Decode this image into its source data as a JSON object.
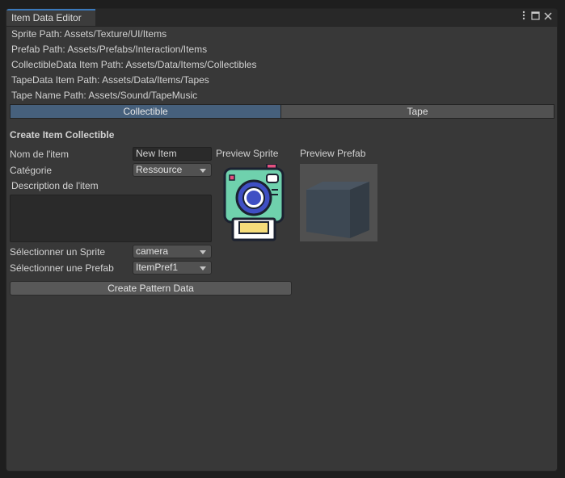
{
  "window": {
    "tab_title": "Item Data Editor",
    "menu_icon": "kebab-menu-icon",
    "maximize_icon": "maximize-icon",
    "close_icon": "close-icon"
  },
  "paths": [
    "Sprite Path: Assets/Texture/UI/Items",
    "Prefab Path: Assets/Prefabs/Interaction/Items",
    "CollectibleData Item Path: Assets/Data/Items/Collectibles",
    "TapeData Item Path: Assets/Data/Items/Tapes",
    "Tape Name Path: Assets/Sound/TapeMusic"
  ],
  "mode_toggle": {
    "collectible": "Collectible",
    "tape": "Tape",
    "active": "Collectible",
    "active_color": "#46607c"
  },
  "form": {
    "section_title": "Create Item Collectible",
    "name_label": "Nom de l'item",
    "name_value": "New Item",
    "category_label": "Catégorie",
    "category_value": "Ressource",
    "description_label": "Description de l'item",
    "description_value": "",
    "sprite_label": "Sélectionner un Sprite",
    "sprite_value": "camera",
    "prefab_label": "Sélectionner une Prefab",
    "prefab_value": "ItemPref1",
    "create_button": "Create Pattern Data"
  },
  "preview": {
    "sprite_label": "Preview Sprite",
    "prefab_label": "Preview Prefab",
    "sprite_icon": "camera-icon",
    "prefab_icon": "cube-icon"
  }
}
